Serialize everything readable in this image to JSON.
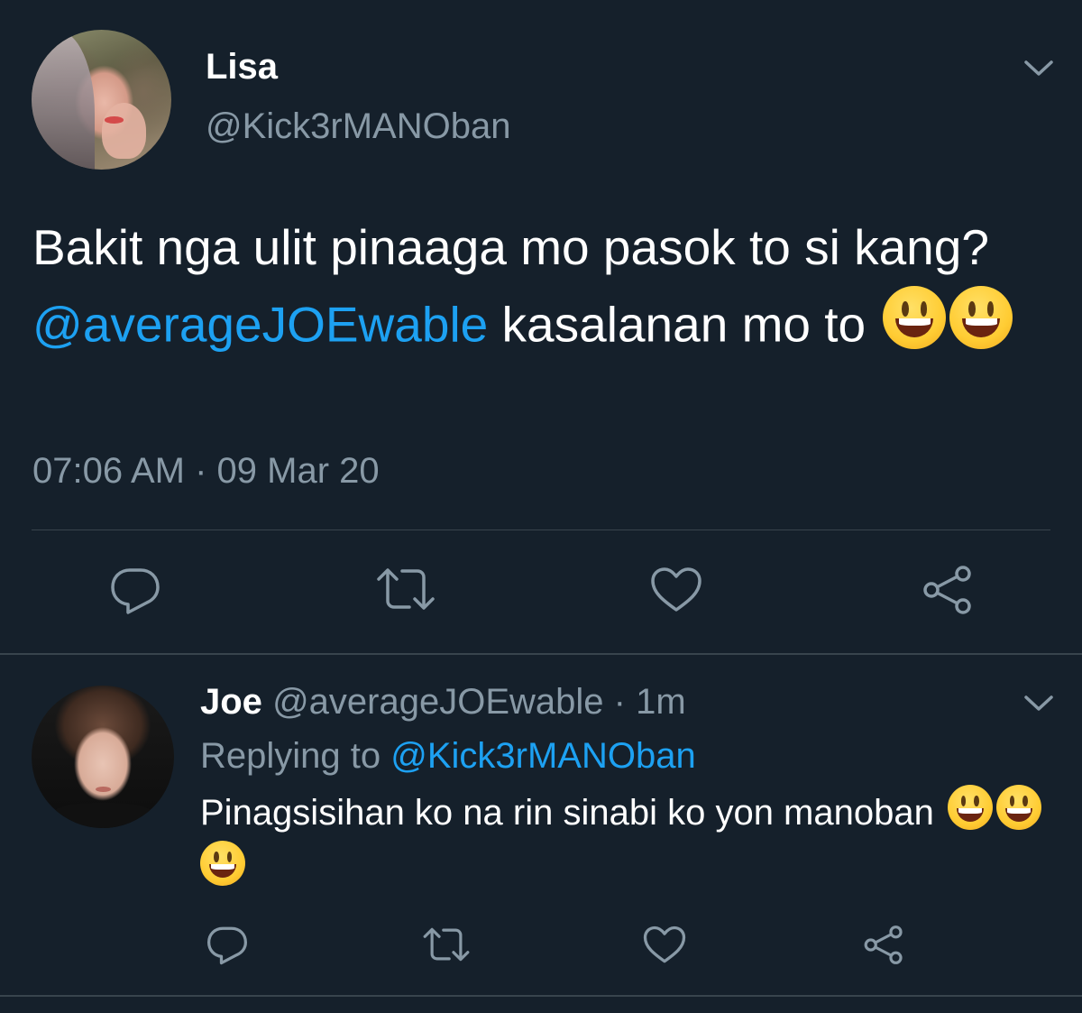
{
  "main_tweet": {
    "author_name": "Lisa",
    "author_handle": "@Kick3rMANOban",
    "text_before_mention": "Bakit nga ulit pinaaga mo pasok to si kang? ",
    "mention": "@averageJOEwable",
    "text_after_mention": " kasalanan mo to",
    "emojis": [
      "grinning-face-emoji",
      "grinning-face-emoji"
    ],
    "timestamp": "07:06 AM · 09 Mar 20"
  },
  "reply_tweet": {
    "author_name": "Joe",
    "author_handle": "@averageJOEwable",
    "separator": " · ",
    "age": "1m",
    "replying_prefix": "Replying to ",
    "replying_handle": "@Kick3rMANOban",
    "text": "Pinagsisihan ko na rin sinabi ko yon manoban",
    "emojis": [
      "grinning-face-emoji",
      "grinning-face-emoji",
      "grinning-face-emoji"
    ]
  },
  "icons": {
    "reply": "reply-icon",
    "retweet": "retweet-icon",
    "like": "heart-icon",
    "share": "share-icon",
    "menu": "chevron-down-icon"
  },
  "colors": {
    "background": "#15202b",
    "text_primary": "#ffffff",
    "text_secondary": "#8899a6",
    "accent": "#1da1f2",
    "divider": "#38444d"
  }
}
